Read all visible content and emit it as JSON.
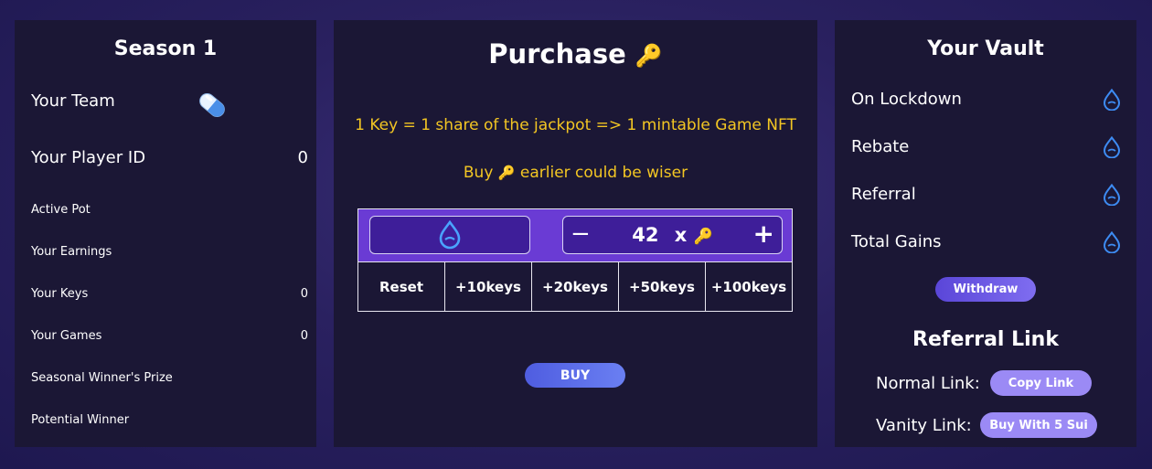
{
  "season": {
    "title": "Season 1",
    "team_label": "Your Team",
    "player_id_label": "Your Player ID",
    "player_id_value": "0",
    "active_pot_label": "Active Pot",
    "earnings_label": "Your Earnings",
    "keys_label": "Your Keys",
    "keys_value": "0",
    "games_label": "Your Games",
    "games_value": "0",
    "prize_label": "Seasonal Winner's Prize",
    "potential_winner_label": "Potential Winner"
  },
  "purchase": {
    "title": "Purchase",
    "title_emoji": "🔑",
    "info_line": "1 Key = 1 share of the jackpot => 1 mintable Game NFT",
    "hint_prefix": "Buy",
    "hint_emoji": "🔑",
    "hint_suffix": "earlier could be wiser",
    "minus": "−",
    "plus": "+",
    "quantity": "42",
    "times": "x",
    "key_emoji": "🔑",
    "quick_buttons": [
      "Reset",
      "+10keys",
      "+20keys",
      "+50keys",
      "+100keys"
    ],
    "buy_label": "BUY"
  },
  "vault": {
    "title": "Your Vault",
    "rows": [
      "On Lockdown",
      "Rebate",
      "Referral",
      "Total Gains"
    ],
    "withdraw_label": "Withdraw",
    "referral_title": "Referral Link",
    "normal_link_label": "Normal Link:",
    "copy_link_label": "Copy Link",
    "vanity_link_label": "Vanity Link:",
    "vanity_button_label": "Buy With 5 Sui"
  },
  "colors": {
    "accent_gold": "#f3c623",
    "accent_purple": "#6a3bd4",
    "drop_blue": "#3d8bf2"
  },
  "icons": {
    "team": "pill-icon",
    "currency": "sui-drop-icon",
    "key": "key-icon"
  }
}
